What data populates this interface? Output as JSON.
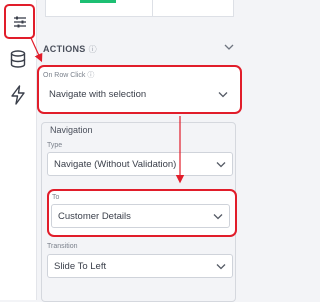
{
  "rail": {
    "items": [
      {
        "icon": "sliders-icon",
        "active": true
      },
      {
        "icon": "database-icon",
        "active": false
      },
      {
        "icon": "lightning-icon",
        "active": false
      }
    ]
  },
  "actions": {
    "title": "ACTIONS",
    "info_icon": "info-icon"
  },
  "on_row_click": {
    "label": "On Row Click",
    "value": "Navigate with selection"
  },
  "navigation": {
    "title": "Navigation",
    "type_label": "Type",
    "type_value": "Navigate (Without Validation)",
    "to_label": "To",
    "to_value": "Customer Details",
    "transition_label": "Transition",
    "transition_value": "Slide To Left"
  },
  "colors": {
    "highlight": "#e11d2a",
    "accent": "#1dbf73"
  }
}
